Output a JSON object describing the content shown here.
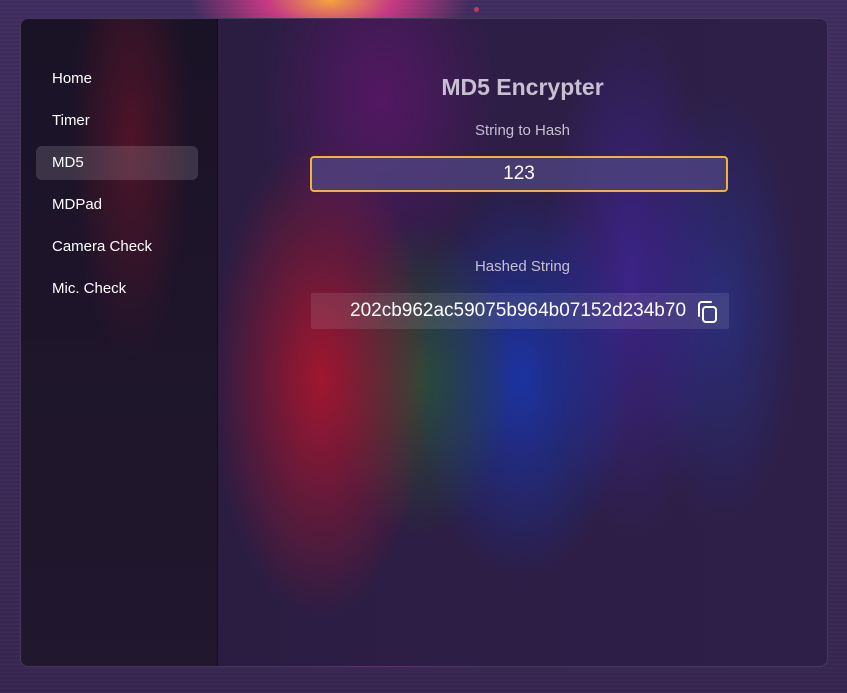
{
  "sidebar": {
    "items": [
      {
        "label": "Home",
        "active": false
      },
      {
        "label": "Timer",
        "active": false
      },
      {
        "label": "MD5",
        "active": true
      },
      {
        "label": "MDPad",
        "active": false
      },
      {
        "label": "Camera Check",
        "active": false
      },
      {
        "label": "Mic. Check",
        "active": false
      }
    ]
  },
  "main": {
    "title": "MD5 Encrypter",
    "input_label": "String to Hash",
    "input_value": "123",
    "output_label": "Hashed String",
    "output_value": "202cb962ac59075b964b07152d234b70",
    "copy_icon": "copy-icon"
  },
  "colors": {
    "input_border": "#f0b23a",
    "title": "#c7c0d2",
    "text": "#ffffff"
  }
}
